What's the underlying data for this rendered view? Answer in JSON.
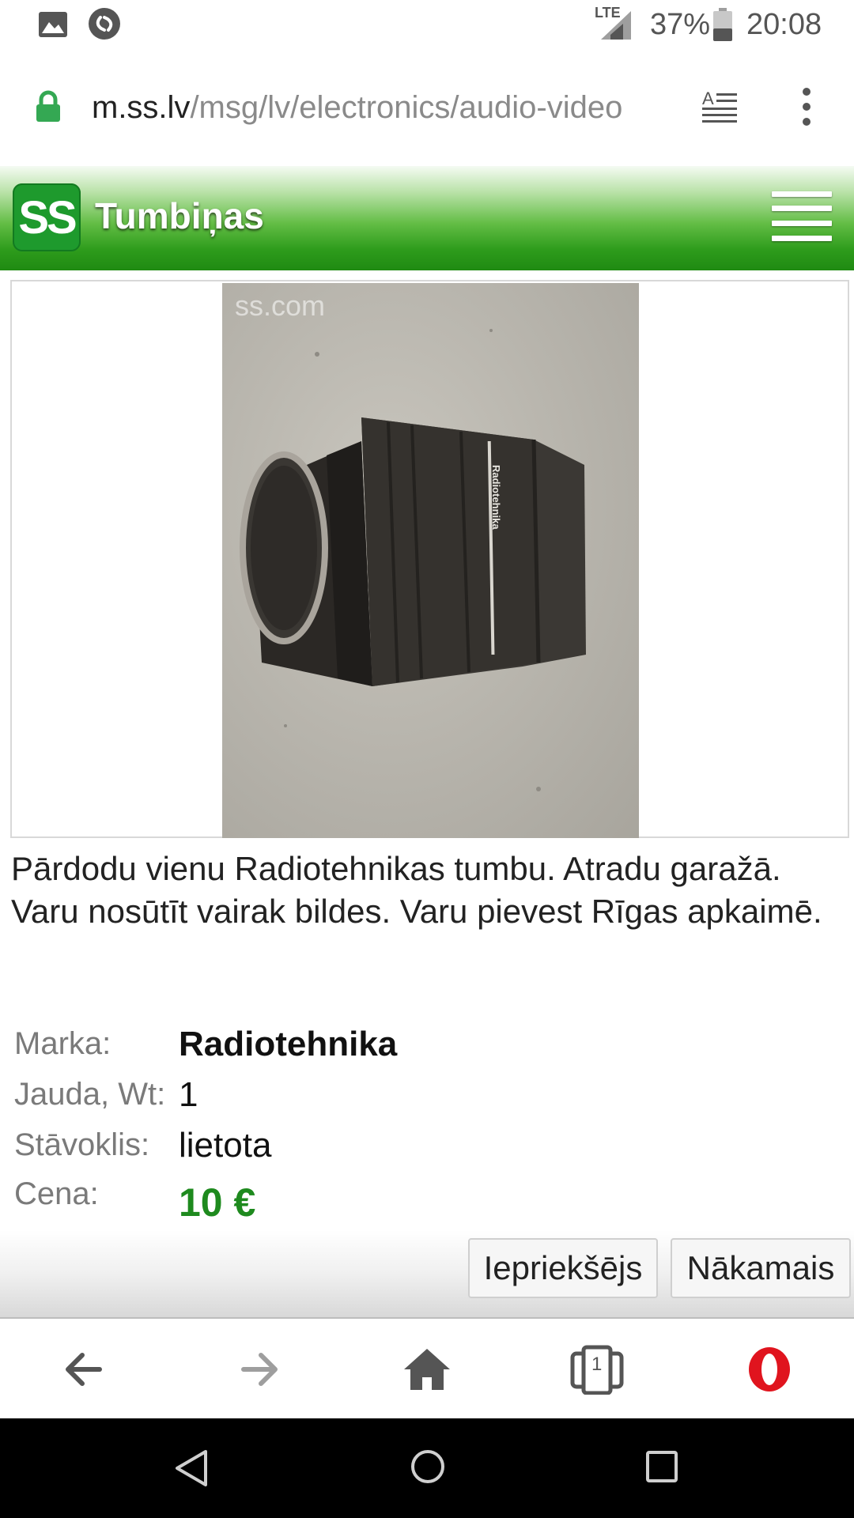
{
  "status_bar": {
    "network": "LTE",
    "battery": "37%",
    "time": "20:08"
  },
  "url_bar": {
    "domain": "m.ss.lv",
    "path": "/msg/lv/electronics/audio-video"
  },
  "header": {
    "logo_text": "SS",
    "title": "Tumbiņas"
  },
  "photo": {
    "watermark": "ss.com",
    "brand_text": "Radiotehnika"
  },
  "description": "Pārdodu vienu Radiotehnikas tumbu. Atradu garažā. Varu nosūtīt vairak bildes. Varu pievest Rīgas apkaimē.",
  "details": [
    {
      "label": "Marka:",
      "value": "Radiotehnika"
    },
    {
      "label": "Jauda, Wt:",
      "value": "1"
    },
    {
      "label": "Stāvoklis:",
      "value": "lietota"
    },
    {
      "label": "Cena:",
      "value": "10 €"
    }
  ],
  "navigation": {
    "prev_label": "Iepriekšējs",
    "next_label": "Nākamais"
  },
  "browser_bar": {
    "tab_count": "1"
  },
  "colors": {
    "price": "#1e8a1e",
    "header_green": "#2e9c1c",
    "logo_green": "#1e9a2d",
    "opera_red": "#e0141e"
  }
}
